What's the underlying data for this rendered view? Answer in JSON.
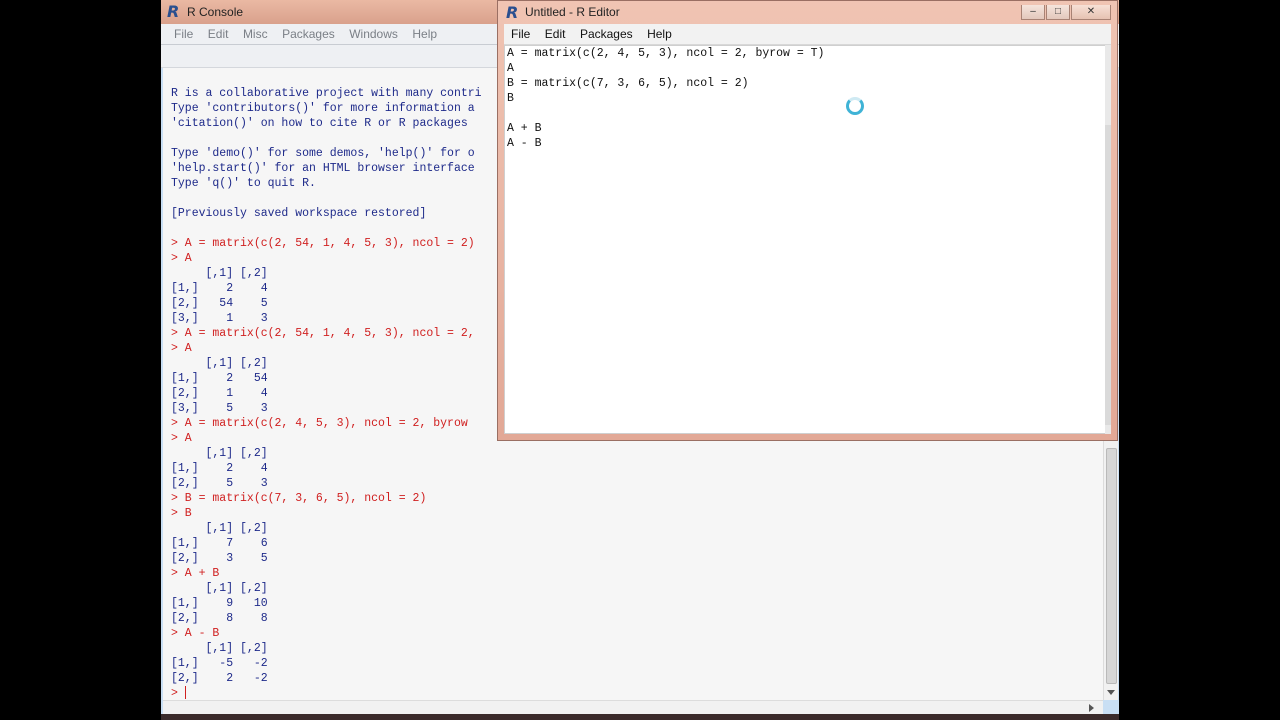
{
  "console": {
    "title": "R Console",
    "menu": [
      "File",
      "Edit",
      "Misc",
      "Packages",
      "Windows",
      "Help"
    ],
    "lines": [
      {
        "type": "out",
        "text": ""
      },
      {
        "type": "out",
        "text": "R is a collaborative project with many contri"
      },
      {
        "type": "out",
        "text": "Type 'contributors()' for more information a"
      },
      {
        "type": "out",
        "text": "'citation()' on how to cite R or R packages"
      },
      {
        "type": "out",
        "text": ""
      },
      {
        "type": "out",
        "text": "Type 'demo()' for some demos, 'help()' for o"
      },
      {
        "type": "out",
        "text": "'help.start()' for an HTML browser interface"
      },
      {
        "type": "out",
        "text": "Type 'q()' to quit R."
      },
      {
        "type": "out",
        "text": ""
      },
      {
        "type": "out",
        "text": "[Previously saved workspace restored]"
      },
      {
        "type": "out",
        "text": ""
      },
      {
        "type": "cmd",
        "text": "> A = matrix(c(2, 54, 1, 4, 5, 3), ncol = 2)"
      },
      {
        "type": "cmd",
        "text": "> A"
      },
      {
        "type": "out",
        "text": "     [,1] [,2]"
      },
      {
        "type": "out",
        "text": "[1,]    2    4"
      },
      {
        "type": "out",
        "text": "[2,]   54    5"
      },
      {
        "type": "out",
        "text": "[3,]    1    3"
      },
      {
        "type": "cmd",
        "text": "> A = matrix(c(2, 54, 1, 4, 5, 3), ncol = 2,"
      },
      {
        "type": "cmd",
        "text": "> A"
      },
      {
        "type": "out",
        "text": "     [,1] [,2]"
      },
      {
        "type": "out",
        "text": "[1,]    2   54"
      },
      {
        "type": "out",
        "text": "[2,]    1    4"
      },
      {
        "type": "out",
        "text": "[3,]    5    3"
      },
      {
        "type": "cmd",
        "text": "> A = matrix(c(2, 4, 5, 3), ncol = 2, byrow"
      },
      {
        "type": "cmd",
        "text": "> A"
      },
      {
        "type": "out",
        "text": "     [,1] [,2]"
      },
      {
        "type": "out",
        "text": "[1,]    2    4"
      },
      {
        "type": "out",
        "text": "[2,]    5    3"
      },
      {
        "type": "cmd",
        "text": "> B = matrix(c(7, 3, 6, 5), ncol = 2)"
      },
      {
        "type": "cmd",
        "text": "> B"
      },
      {
        "type": "out",
        "text": "     [,1] [,2]"
      },
      {
        "type": "out",
        "text": "[1,]    7    6"
      },
      {
        "type": "out",
        "text": "[2,]    3    5"
      },
      {
        "type": "cmd",
        "text": "> A + B"
      },
      {
        "type": "out",
        "text": "     [,1] [,2]"
      },
      {
        "type": "out",
        "text": "[1,]    9   10"
      },
      {
        "type": "out",
        "text": "[2,]    8    8"
      },
      {
        "type": "cmd",
        "text": "> A - B"
      },
      {
        "type": "out",
        "text": "     [,1] [,2]"
      },
      {
        "type": "out",
        "text": "[1,]   -5   -2"
      },
      {
        "type": "out",
        "text": "[2,]    2   -2"
      }
    ],
    "prompt": "> "
  },
  "editor": {
    "title": "Untitled - R Editor",
    "menu": [
      "File",
      "Edit",
      "Packages",
      "Help"
    ],
    "lines": [
      "A = matrix(c(2, 4, 5, 3), ncol = 2, byrow = T)",
      "A",
      "B = matrix(c(7, 3, 6, 5), ncol = 2)",
      "B",
      "",
      "A + B",
      "A - B"
    ],
    "window_buttons": {
      "minimize": "–",
      "maximize": "□",
      "close": "✕"
    }
  },
  "colors": {
    "console_command": "#d02020",
    "console_output": "#1e2a8a",
    "title_bar": "#e2a896"
  }
}
